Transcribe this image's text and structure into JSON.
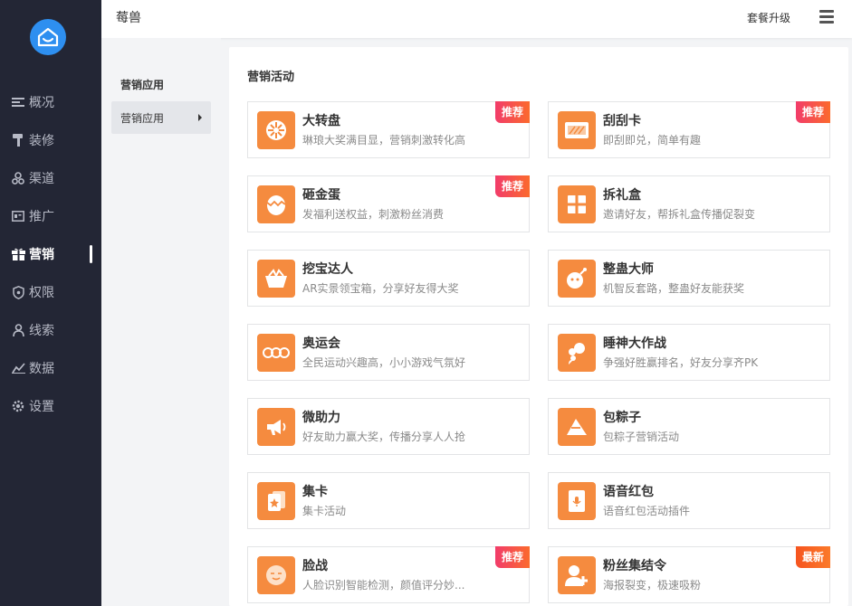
{
  "sidebar": {
    "items": [
      {
        "label": "概况",
        "icon": "overview-icon"
      },
      {
        "label": "装修",
        "icon": "brush-icon"
      },
      {
        "label": "渠道",
        "icon": "channel-icon"
      },
      {
        "label": "推广",
        "icon": "promotion-icon"
      },
      {
        "label": "营销",
        "icon": "gift-icon",
        "active": true
      },
      {
        "label": "权限",
        "icon": "shield-icon"
      },
      {
        "label": "线索",
        "icon": "person-icon"
      },
      {
        "label": "数据",
        "icon": "chart-icon"
      },
      {
        "label": "设置",
        "icon": "gear-icon"
      }
    ]
  },
  "header": {
    "shop_name": "莓兽",
    "upgrade_label": "套餐升级"
  },
  "subnav": {
    "title": "营销应用",
    "item_label": "营销应用"
  },
  "main": {
    "section_title": "营销活动",
    "cards": [
      {
        "title": "大转盘",
        "desc": "琳琅大奖满目显，营销刺激转化高",
        "badge": "推荐",
        "icon": "wheel-icon"
      },
      {
        "title": "刮刮卡",
        "desc": "即刮即兑，简单有趣",
        "badge": "推荐",
        "icon": "scratch-card-icon"
      },
      {
        "title": "砸金蛋",
        "desc": "发福利送权益，刺激粉丝消费",
        "badge": "推荐",
        "icon": "golden-egg-icon"
      },
      {
        "title": "拆礼盒",
        "desc": "邀请好友，帮拆礼盒传播促裂变",
        "badge": "",
        "icon": "gift-box-icon"
      },
      {
        "title": "挖宝达人",
        "desc": "AR实景领宝箱，分享好友得大奖",
        "badge": "",
        "icon": "treasure-icon"
      },
      {
        "title": "整蛊大师",
        "desc": "机智反套路，整蛊好友能获奖",
        "badge": "",
        "icon": "bomb-icon"
      },
      {
        "title": "奥运会",
        "desc": "全民运动兴趣高，小小游戏气氛好",
        "badge": "",
        "icon": "olympic-rings-icon"
      },
      {
        "title": "睡神大作战",
        "desc": "争强好胜赢排名，好友分享齐PK",
        "badge": "",
        "icon": "sleep-icon"
      },
      {
        "title": "微助力",
        "desc": "好友助力赢大奖，传播分享人人抢",
        "badge": "",
        "icon": "megaphone-icon"
      },
      {
        "title": "包粽子",
        "desc": "包粽子营销活动",
        "badge": "",
        "icon": "zongzi-icon"
      },
      {
        "title": "集卡",
        "desc": "集卡活动",
        "badge": "",
        "icon": "cards-icon"
      },
      {
        "title": "语音红包",
        "desc": "语音红包活动插件",
        "badge": "",
        "icon": "voice-envelope-icon"
      },
      {
        "title": "脸战",
        "desc": "人脸识别智能检测，颜值评分妙...",
        "badge": "推荐",
        "icon": "face-icon"
      },
      {
        "title": "粉丝集结令",
        "desc": "海报裂变，极速吸粉",
        "badge": "最新",
        "icon": "add-user-icon"
      }
    ]
  }
}
